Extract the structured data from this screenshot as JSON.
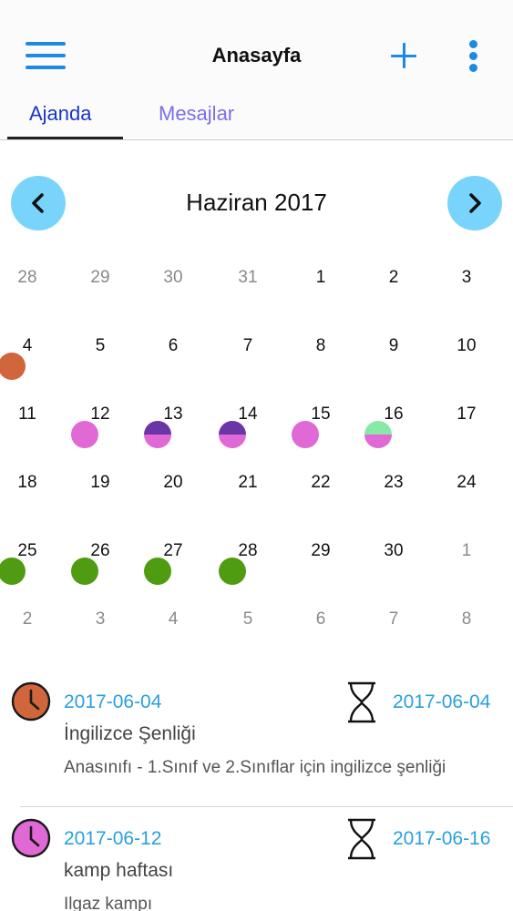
{
  "header": {
    "title": "Anasayfa",
    "menu_icon": "hamburger-menu-icon",
    "add_icon": "plus-icon",
    "more_icon": "more-vertical-icon",
    "accent_color": "#1e88e5"
  },
  "tabs": [
    {
      "label": "Ajanda",
      "active": true
    },
    {
      "label": "Mesajlar",
      "active": false
    }
  ],
  "calendar": {
    "month_label": "Haziran 2017",
    "prev_icon": "chevron-left-icon",
    "next_icon": "chevron-right-icon",
    "weeks": [
      [
        {
          "d": "28",
          "o": true
        },
        {
          "d": "29",
          "o": true
        },
        {
          "d": "30",
          "o": true
        },
        {
          "d": "31",
          "o": true
        },
        {
          "d": "1"
        },
        {
          "d": "2"
        },
        {
          "d": "3"
        }
      ],
      [
        {
          "d": "4",
          "dots": [
            "#d1653b"
          ]
        },
        {
          "d": "5"
        },
        {
          "d": "6"
        },
        {
          "d": "7"
        },
        {
          "d": "8"
        },
        {
          "d": "9"
        },
        {
          "d": "10"
        }
      ],
      [
        {
          "d": "11"
        },
        {
          "d": "12",
          "dots": [
            "#e069d6"
          ]
        },
        {
          "d": "13",
          "dots": [
            "#6a35a6",
            "#e069d6"
          ]
        },
        {
          "d": "14",
          "dots": [
            "#6a35a6",
            "#e069d6"
          ]
        },
        {
          "d": "15",
          "dots": [
            "#e069d6"
          ]
        },
        {
          "d": "16",
          "dots": [
            "#88e8a6",
            "#e069d6"
          ]
        },
        {
          "d": "17"
        }
      ],
      [
        {
          "d": "18"
        },
        {
          "d": "19"
        },
        {
          "d": "20"
        },
        {
          "d": "21"
        },
        {
          "d": "22"
        },
        {
          "d": "23"
        },
        {
          "d": "24"
        }
      ],
      [
        {
          "d": "25",
          "dots": [
            "#4f9c12"
          ]
        },
        {
          "d": "26",
          "dots": [
            "#4f9c12"
          ]
        },
        {
          "d": "27",
          "dots": [
            "#4f9c12"
          ]
        },
        {
          "d": "28",
          "dots": [
            "#4f9c12"
          ]
        },
        {
          "d": "29"
        },
        {
          "d": "30"
        },
        {
          "d": "1",
          "o": true
        }
      ],
      [
        {
          "d": "2",
          "o": true
        },
        {
          "d": "3",
          "o": true
        },
        {
          "d": "4",
          "o": true
        },
        {
          "d": "5",
          "o": true
        },
        {
          "d": "6",
          "o": true
        },
        {
          "d": "7",
          "o": true
        },
        {
          "d": "8",
          "o": true
        }
      ]
    ]
  },
  "events": [
    {
      "start_date": "2017-06-04",
      "end_date": "2017-06-04",
      "title": "İngilizce Şenliği",
      "description": "Anasınıfı - 1.Sınıf ve 2.Sınıflar için ingilizce şenliği",
      "color": "#d1653b",
      "clock_icon": "clock-icon",
      "hourglass_icon": "hourglass-icon"
    },
    {
      "start_date": "2017-06-12",
      "end_date": "2017-06-16",
      "title": "kamp haftası",
      "description": "Ilgaz kampı",
      "color": "#e069d6",
      "clock_icon": "clock-icon",
      "hourglass_icon": "hourglass-icon"
    }
  ]
}
